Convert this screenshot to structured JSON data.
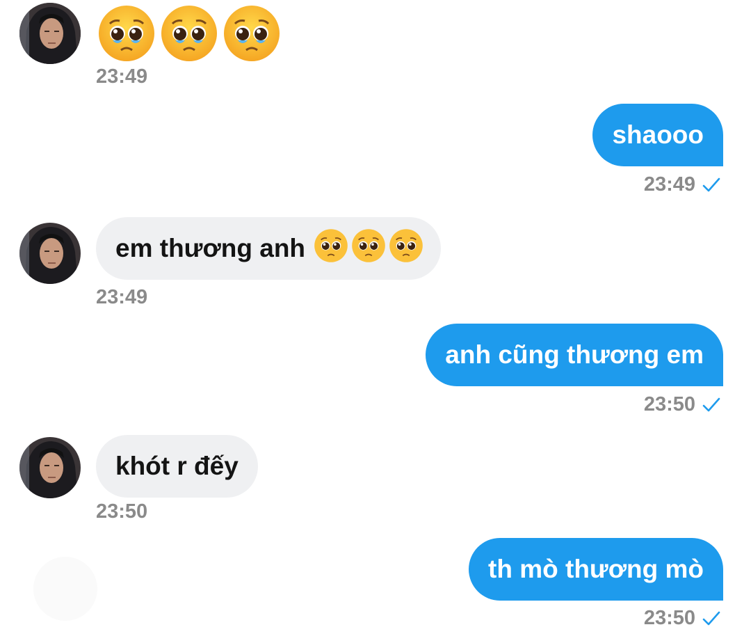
{
  "messages": [
    {
      "side": "in",
      "text": "",
      "emoji_count": 3,
      "emoji_icon": "pleading-face-icon",
      "time": "23:49"
    },
    {
      "side": "out",
      "text": "shaooo",
      "time": "23:49",
      "status_icon": "sent-check-icon"
    },
    {
      "side": "in",
      "text": "em thương anh",
      "emoji_count": 3,
      "emoji_icon": "pleading-face-icon",
      "time": "23:49"
    },
    {
      "side": "out",
      "text": "anh cũng thương em",
      "time": "23:50",
      "status_icon": "sent-check-icon"
    },
    {
      "side": "in",
      "text": "khót r đếy",
      "time": "23:50"
    },
    {
      "side": "out",
      "text": "th mò thương mò",
      "time": "23:50",
      "status_icon": "sent-check-icon"
    }
  ],
  "colors": {
    "outgoing_bubble": "#1e9bed",
    "incoming_bubble": "#eff0f2",
    "timestamp": "#8a8a8a",
    "check": "#1e9bed"
  }
}
